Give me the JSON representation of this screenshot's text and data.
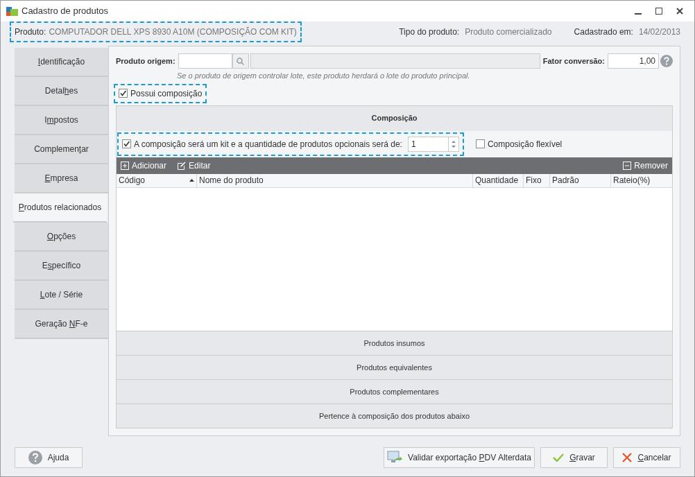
{
  "window": {
    "title": "Cadastro de produtos"
  },
  "header": {
    "product_label": "Produto:",
    "product_value": "COMPUTADOR DELL XPS 8930 A10M (COMPOSIÇÃO COM KIT)",
    "highlighted": true,
    "type_label": "Tipo do produto:",
    "type_value": "Produto comercializado",
    "date_label": "Cadastrado em:",
    "date_value": "14/02/2013"
  },
  "tabs": [
    {
      "access_key": "I",
      "label_after": "dentificação",
      "selected": false
    },
    {
      "label_before": "Detal",
      "access_key": "h",
      "label_after": "es",
      "selected": false
    },
    {
      "label_before": "I",
      "access_key": "m",
      "label_after": "postos",
      "selected": false
    },
    {
      "label_before": "Complemen",
      "access_key": "t",
      "label_after": "ar",
      "selected": false
    },
    {
      "access_key": "E",
      "label_after": "mpresa",
      "selected": false
    },
    {
      "access_key": "P",
      "label_after": "rodutos relacionados",
      "selected": true
    },
    {
      "access_key": "O",
      "label_after": "pções",
      "selected": false
    },
    {
      "label_before": "E",
      "access_key": "s",
      "label_after": "pecífico",
      "selected": false
    },
    {
      "access_key": "L",
      "label_after": "ote / Série",
      "selected": false
    },
    {
      "label_before": "Geração ",
      "access_key": "N",
      "label_after": "F-e",
      "selected": false
    }
  ],
  "origin": {
    "label": "Produto origem:",
    "hint": "Se o produto de origem controlar lote, este produto herdará o lote do produto principal.",
    "factor_label": "Fator conversão:",
    "factor_value": "1,00"
  },
  "has_composition": {
    "label": "Possui composição",
    "checked": true,
    "highlighted": true
  },
  "composition": {
    "title": "Composição",
    "kit": {
      "label": "A composição será um kit e a quantidade de produtos opcionais será de:",
      "checked": true,
      "value": "1",
      "highlighted": true
    },
    "flexible": {
      "label": "Composição flexível",
      "checked": false
    },
    "toolbar": {
      "add": "Adicionar",
      "edit": "Editar",
      "remove": "Remover"
    },
    "columns": [
      {
        "label": "Código",
        "sorted": true
      },
      {
        "label": "Nome do produto",
        "sorted": false
      },
      {
        "label": "Quantidade",
        "sorted": false
      },
      {
        "label": "Fixo",
        "sorted": false
      },
      {
        "label": "Padrão",
        "sorted": false
      },
      {
        "label": "Rateio(%)",
        "sorted": false
      }
    ]
  },
  "sections": [
    "Produtos insumos",
    "Produtos equivalentes",
    "Produtos complementares",
    "Pertence à composição dos produtos abaixo"
  ],
  "buttons": {
    "help": {
      "label_after": "Ajuda"
    },
    "validate": {
      "label_before": "Validar exportação ",
      "access_key": "P",
      "label_after": "DV Alterdata"
    },
    "save": {
      "access_key": "G",
      "label_after": "ravar"
    },
    "cancel": {
      "access_key": "C",
      "label_after": "ancelar"
    }
  }
}
